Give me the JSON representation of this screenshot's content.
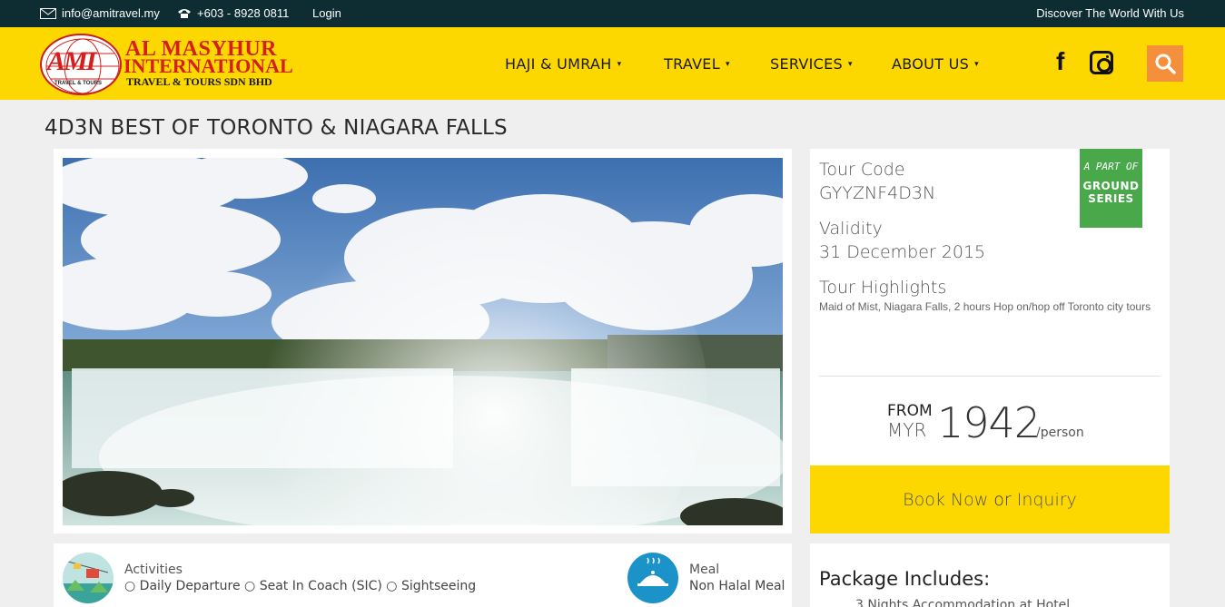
{
  "topbar": {
    "email": "info@amitravel.my",
    "phone": "+603 - 8928 0811",
    "login": "Login",
    "tagline": "Discover The World With Us"
  },
  "logo": {
    "mark": "AMI",
    "mark_sub": "TRAVEL & TOURS",
    "line1": "AL MASYHUR",
    "line2": "INTERNATIONAL",
    "line3": "TRAVEL & TOURS SDN BHD"
  },
  "nav": [
    {
      "label": "HAJI & UMRAH",
      "caret": "▾"
    },
    {
      "label": "TRAVEL",
      "caret": "▾"
    },
    {
      "label": "SERVICES",
      "caret": "▾"
    },
    {
      "label": "ABOUT US",
      "caret": "▾"
    }
  ],
  "social": {
    "facebook": "f"
  },
  "page": {
    "title": "4D3N BEST OF TORONTO & NIAGARA FALLS"
  },
  "tour": {
    "code_label": "Tour Code",
    "code": "GYYZNF4D3N",
    "validity_label": "Validity",
    "validity": "31 December 2015",
    "highlights_label": "Tour Highlights",
    "highlights": "Maid of Mist, Niagara Falls, 2 hours Hop on/hop off Toronto city tours"
  },
  "badge": {
    "line1": "A PART OF",
    "line2": "GROUND",
    "line3": "SERIES"
  },
  "price": {
    "from": "FROM",
    "currency": "MYR",
    "amount": "1942",
    "per": "/person"
  },
  "book": {
    "book_now": "Book Now",
    "or": "or",
    "inquiry": "Inquiry"
  },
  "activities": {
    "label": "Activities",
    "items": "○ Daily Departure ○ Seat In Coach (SIC) ○ Sightseeing"
  },
  "meal": {
    "label": "Meal",
    "value": "Non Halal Meal"
  },
  "package": {
    "heading": "Package Includes:",
    "first_item": "3 Nights Accommodation at Hotel"
  },
  "colors": {
    "topbar": "#0d2d33",
    "header": "#fcd800",
    "search": "#f4903c",
    "badge": "#48a84a"
  },
  "icons": [
    "mail-icon",
    "phone-icon",
    "facebook-icon",
    "instagram-icon",
    "search-icon",
    "activities-icon",
    "meal-icon"
  ]
}
